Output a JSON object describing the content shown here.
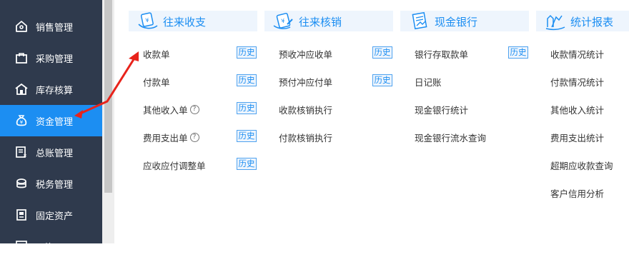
{
  "sidebar": {
    "items": [
      {
        "label": "销售管理",
        "icon": "home-tag-icon",
        "active": false
      },
      {
        "label": "采购管理",
        "icon": "shopping-bag-icon",
        "active": false
      },
      {
        "label": "库存核算",
        "icon": "warehouse-icon",
        "active": false
      },
      {
        "label": "资金管理",
        "icon": "money-bag-icon",
        "active": true
      },
      {
        "label": "总账管理",
        "icon": "ledger-icon",
        "active": false
      },
      {
        "label": "税务管理",
        "icon": "tax-icon",
        "active": false
      },
      {
        "label": "固定资产",
        "icon": "fixed-asset-icon",
        "active": false
      },
      {
        "label": "工资",
        "icon": "salary-icon",
        "active": false
      }
    ]
  },
  "columns": [
    {
      "title": "往来收支",
      "icon": "receipt-icon",
      "items": [
        {
          "label": "收款单",
          "history": "历史",
          "help": false
        },
        {
          "label": "付款单",
          "history": "历史",
          "help": false
        },
        {
          "label": "其他收入单",
          "history": "历史",
          "help": true
        },
        {
          "label": "费用支出单",
          "history": "历史",
          "help": true
        },
        {
          "label": "应收应付调整单",
          "history": "历史",
          "help": false
        }
      ]
    },
    {
      "title": "往来核销",
      "icon": "writeoff-icon",
      "items": [
        {
          "label": "预收冲应收单",
          "history": "历史"
        },
        {
          "label": "预付冲应付单",
          "history": "历史"
        },
        {
          "label": "收款核销执行"
        },
        {
          "label": "付款核销执行"
        }
      ]
    },
    {
      "title": "现金银行",
      "icon": "bank-document-icon",
      "items": [
        {
          "label": "银行存取款单",
          "history": "历史"
        },
        {
          "label": "日记账"
        },
        {
          "label": "现金银行统计"
        },
        {
          "label": "现金银行流水查询"
        }
      ]
    },
    {
      "title": "统计报表",
      "icon": "statistics-icon",
      "items": [
        {
          "label": "收款情况统计"
        },
        {
          "label": "付款情况统计"
        },
        {
          "label": "其他收入统计"
        },
        {
          "label": "费用支出统计"
        },
        {
          "label": "超期应收款查询"
        },
        {
          "label": "客户信用分析"
        }
      ]
    }
  ],
  "colors": {
    "sidebar_bg": "#2f3a4d",
    "active_bg": "#1c8ef2",
    "accent": "#1c8ef2",
    "header_bg": "#eef5fd",
    "annotation_arrow": "#e8231b"
  },
  "help_glyph": "?"
}
